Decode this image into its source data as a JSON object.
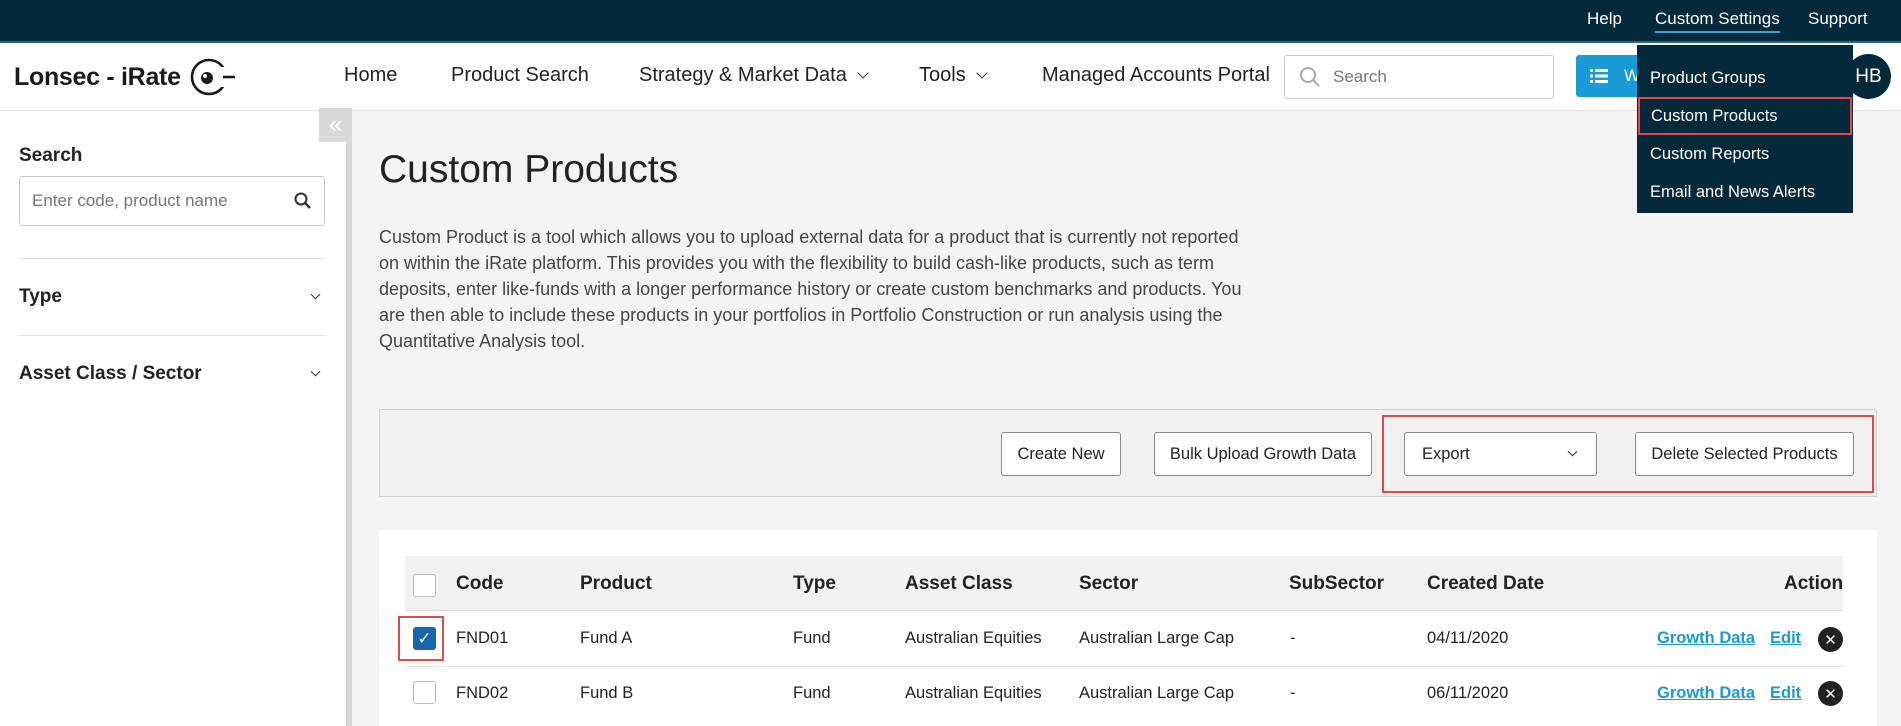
{
  "utility": {
    "help": "Help",
    "custom_settings": "Custom Settings",
    "support": "Support"
  },
  "header": {
    "logo": "Lonsec - iRate",
    "nav": [
      "Home",
      "Product Search",
      "Strategy & Market Data",
      "Tools",
      "Managed Accounts Portal"
    ],
    "search_placeholder": "Search",
    "blue_button_label": "W",
    "avatar_initials": "HB"
  },
  "dropdown": {
    "items": [
      "Product Groups",
      "Custom Products",
      "Custom Reports",
      "Email and News Alerts"
    ],
    "highlighted": "Custom Products"
  },
  "sidebar": {
    "collapse_label": "«",
    "search_label": "Search",
    "search_placeholder": "Enter code, product name",
    "filters": [
      "Type",
      "Asset Class / Sector"
    ]
  },
  "main": {
    "title": "Custom Products",
    "description": "Custom Product is a tool which allows you to upload external data for a product that is currently not reported on within the iRate platform. This provides you with the flexibility to build cash-like products, such as term deposits, enter like-funds with a longer performance history or create custom benchmarks and products. You are then able to include these products in your portfolios in Portfolio Construction or run analysis using the Quantitative Analysis tool.",
    "buttons": {
      "create_new": "Create New",
      "bulk_upload": "Bulk Upload Growth Data",
      "export": "Export",
      "delete_selected": "Delete Selected Products"
    }
  },
  "table": {
    "columns": [
      "Code",
      "Product",
      "Type",
      "Asset Class",
      "Sector",
      "SubSector",
      "Created Date",
      "Action"
    ],
    "rows": [
      {
        "checked": true,
        "code": "FND01",
        "product": "Fund A",
        "type": "Fund",
        "asset_class": "Australian Equities",
        "sector": "Australian Large Cap",
        "subsector": "-",
        "created": "04/11/2020",
        "growth": "Growth Data",
        "edit": "Edit"
      },
      {
        "checked": false,
        "code": "FND02",
        "product": "Fund B",
        "type": "Fund",
        "asset_class": "Australian Equities",
        "sector": "Australian Large Cap",
        "subsector": "-",
        "created": "06/11/2020",
        "growth": "Growth Data",
        "edit": "Edit"
      }
    ]
  },
  "colors": {
    "navy": "#04293a",
    "accent_blue": "#1a9ad6",
    "highlight_red": "#e04a4a",
    "check_blue": "#1565b0"
  }
}
